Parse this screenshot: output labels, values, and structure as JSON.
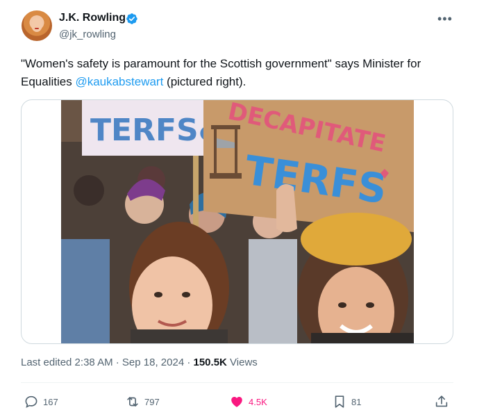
{
  "author": {
    "display_name": "J.K. Rowling",
    "handle": "@jk_rowling",
    "verified_icon": "verified-badge-icon",
    "avatar_icon": "profile-photo"
  },
  "tweet": {
    "text_before": "\"Women's safety is paramount for the Scottish government\" says Minister for Equalities ",
    "mention": "@kaukabstewart",
    "text_after": " (pictured right)."
  },
  "photo": {
    "sign_left_text": "TERFS& T",
    "sign_right_line1": "DECAPITATE",
    "sign_right_line2": "TERFS"
  },
  "meta": {
    "edited": "Last edited 2:38 AM · Sep 18, 2024 · ",
    "views_count": "150.5K",
    "views_label": " Views"
  },
  "actions": {
    "replies": "167",
    "reposts": "797",
    "likes": "4.5K",
    "bookmarks": "81"
  },
  "colors": {
    "accent": "#1d9bf0",
    "like": "#f91880",
    "secondary_text": "#536471"
  }
}
